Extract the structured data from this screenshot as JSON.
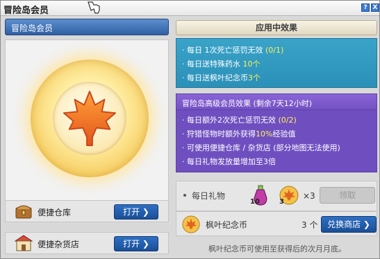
{
  "window": {
    "title": "冒险岛会员"
  },
  "titlebar_buttons": [
    "?",
    "X"
  ],
  "left": {
    "header": "冒险岛会员",
    "features": [
      {
        "label": "便捷仓库",
        "button": "打开 ❯",
        "icon": "treasure-chest-icon"
      },
      {
        "label": "便捷杂货店",
        "button": "打开 ❯",
        "icon": "shop-icon"
      }
    ]
  },
  "right": {
    "header": "应用中效果",
    "basic": [
      {
        "pre": "每日 1次死亡惩罚无效 ",
        "hl": "(0/1)",
        "post": ""
      },
      {
        "pre": "每日送特殊药水 ",
        "hl": "10个",
        "post": ""
      },
      {
        "pre": "每日送枫叶纪念币",
        "hl": "3个",
        "post": ""
      }
    ],
    "premium_title": "冒险岛高级会员效果 (剩余7天12小时)",
    "premium": [
      {
        "pre": "每日额外2次死亡惩罚无效 ",
        "hl": "(0/2)",
        "post": ""
      },
      {
        "pre": "狩猎怪物时额外获得",
        "hl": "10%",
        "post": "经验值"
      },
      {
        "pre": "可使用便捷仓库 / 杂货店  (部分地图无法使用)",
        "hl": "",
        "post": ""
      },
      {
        "pre": "每日礼物发放量增加至3倍",
        "hl": "",
        "post": ""
      }
    ],
    "gift": {
      "label": "每日礼物",
      "potion_count": "10",
      "coin_count": "3",
      "multiplier": "×3",
      "button": "领取"
    },
    "shop": {
      "label": "枫叶纪念币",
      "count": "3 个",
      "button": "兑换商店 ❯"
    },
    "footer": "枫叶纪念币可使用至获得后的次月月底。"
  },
  "colors": {
    "accent": "#2f6fc4",
    "basic_box": "#2b90b8",
    "premium_box": "#7452c4",
    "highlight": "#fff25a"
  }
}
